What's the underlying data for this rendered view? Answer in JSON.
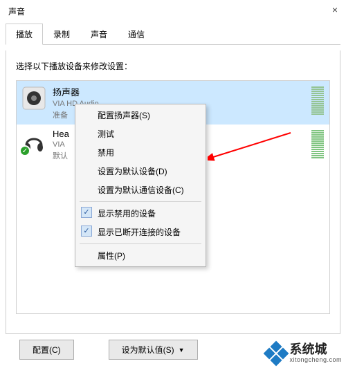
{
  "window": {
    "title": "声音",
    "close": "×"
  },
  "tabs": {
    "playback": "播放",
    "recording": "录制",
    "sounds": "声音",
    "communications": "通信"
  },
  "instruction": "选择以下播放设备来修改设置：",
  "devices": {
    "speaker": {
      "name": "扬声器",
      "desc": "VIA HD Audio",
      "status": "准备"
    },
    "headphone": {
      "name": "Hea",
      "desc": "VIA",
      "status": "默认"
    }
  },
  "contextMenu": {
    "configure": "配置扬声器(S)",
    "test": "测试",
    "disable": "禁用",
    "setDefault": "设置为默认设备(D)",
    "setDefaultComm": "设置为默认通信设备(C)",
    "showDisabled": "显示禁用的设备",
    "showDisconnected": "显示已断开连接的设备",
    "properties": "属性(P)"
  },
  "buttons": {
    "configure": "配置(C)",
    "setDefault": "设为默认值(S)"
  },
  "watermark": {
    "cn": "系统城",
    "en": "xitongcheng.com"
  }
}
